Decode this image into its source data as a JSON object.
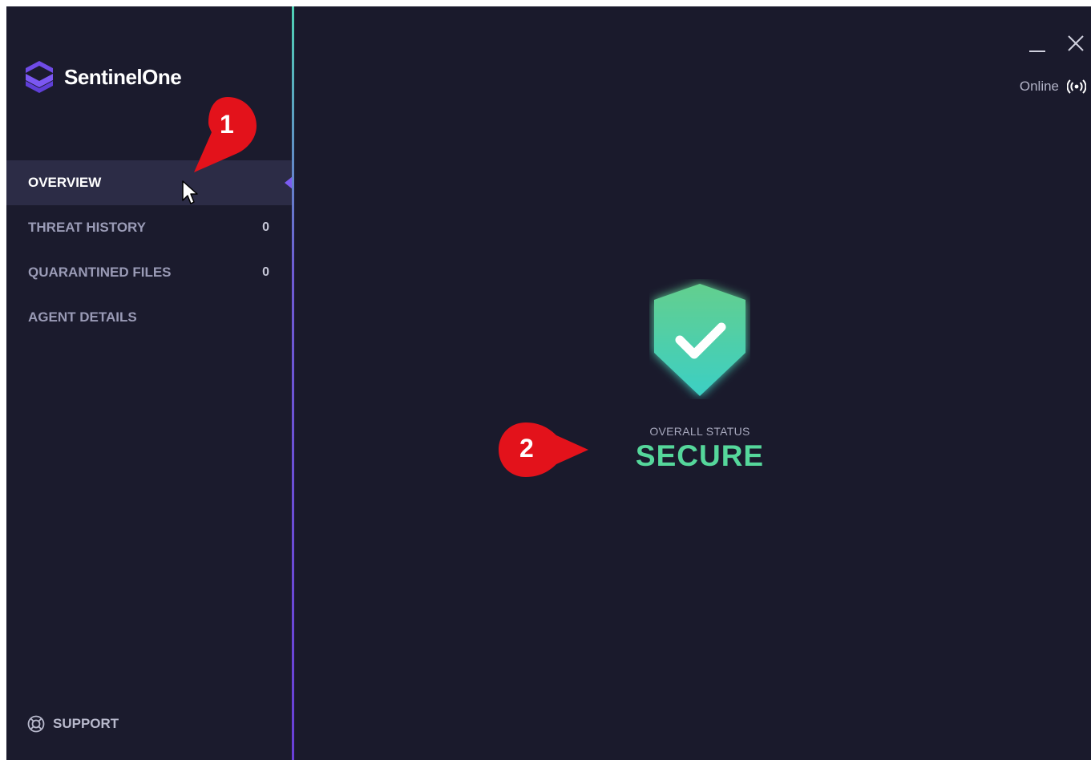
{
  "app": {
    "brand": "SentinelOne"
  },
  "window_controls": {
    "minimize_icon": "minimize-icon",
    "close_icon": "close-icon"
  },
  "connection": {
    "status": "Online",
    "icon": "broadcast-icon"
  },
  "sidebar": {
    "items": [
      {
        "label": "OVERVIEW",
        "count": "",
        "active": true
      },
      {
        "label": "THREAT HISTORY",
        "count": "0",
        "active": false
      },
      {
        "label": "QUARANTINED FILES",
        "count": "0",
        "active": false
      },
      {
        "label": "AGENT DETAILS",
        "count": "",
        "active": false
      }
    ],
    "support": {
      "label": "SUPPORT",
      "icon": "lifebuoy-icon"
    }
  },
  "main": {
    "status_label": "OVERALL STATUS",
    "status_value": "SECURE",
    "status_icon": "shield-check-icon"
  },
  "annotations": {
    "marker_1": "1",
    "marker_2": "2"
  },
  "colors": {
    "background": "#1a1a2c",
    "sidebar_active": "#2c2c46",
    "accent_purple": "#7b5cf0",
    "secure_green": "#55d79b",
    "marker_red": "#e3121b"
  }
}
